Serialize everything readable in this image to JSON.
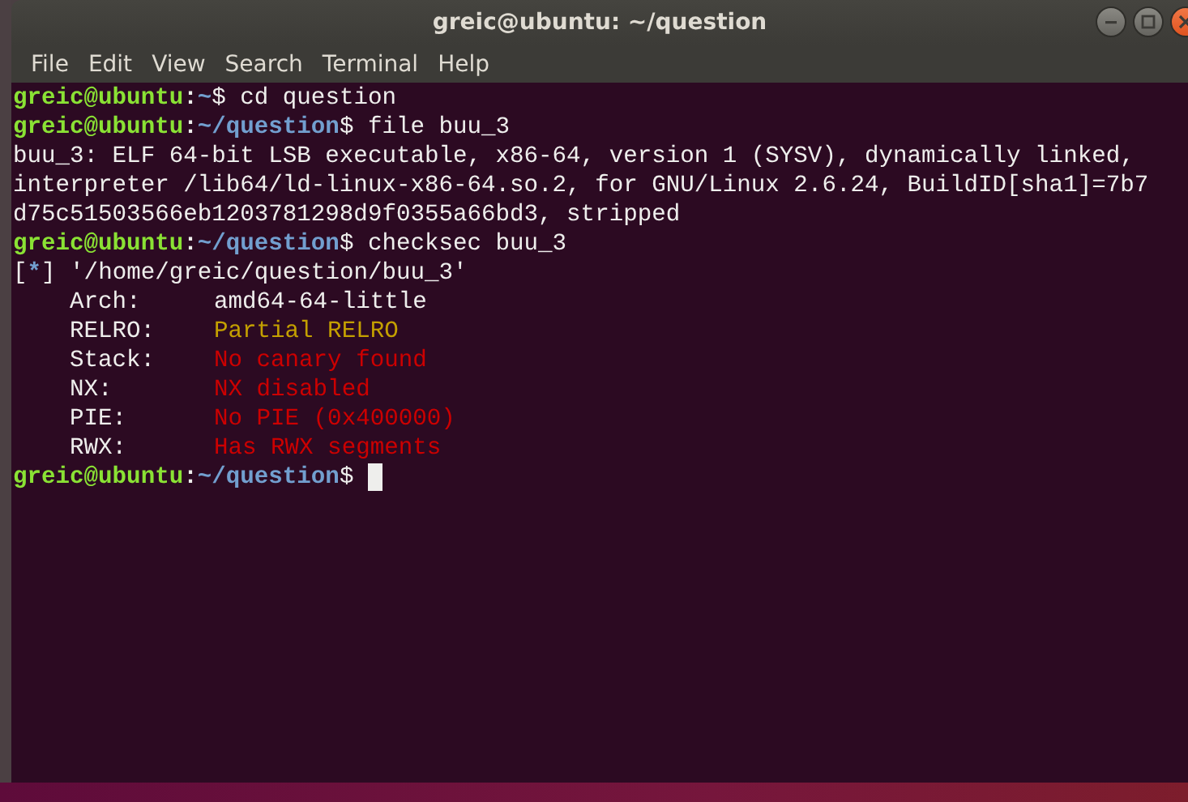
{
  "window": {
    "title": "greic@ubuntu: ~/question"
  },
  "menu": [
    "File",
    "Edit",
    "View",
    "Search",
    "Terminal",
    "Help"
  ],
  "lines": [
    {
      "kind": "prompt",
      "user": "greic@ubuntu",
      "separator": ":",
      "path": "~",
      "symbol": "$",
      "command": " cd question"
    },
    {
      "kind": "prompt",
      "user": "greic@ubuntu",
      "separator": ":",
      "path": "~/question",
      "symbol": "$",
      "command": " file buu_3"
    },
    {
      "kind": "output",
      "text": "buu_3: ELF 64-bit LSB executable, x86-64, version 1 (SYSV), dynamically linked,"
    },
    {
      "kind": "output",
      "text": "interpreter /lib64/ld-linux-x86-64.so.2, for GNU/Linux 2.6.24, BuildID[sha1]=7b7"
    },
    {
      "kind": "output",
      "text": "d75c51503566eb1203781298d9f0355a66bd3, stripped"
    },
    {
      "kind": "prompt",
      "user": "greic@ubuntu",
      "separator": ":",
      "path": "~/question",
      "symbol": "$",
      "command": " checksec buu_3"
    },
    {
      "kind": "info",
      "bracket_open": "[",
      "marker": "*",
      "bracket_close": "]",
      "text": " '/home/greic/question/buu_3'"
    },
    {
      "kind": "field",
      "label": "Arch:",
      "value": "amd64-64-little",
      "color": "#eeeeec"
    },
    {
      "kind": "field",
      "label": "RELRO:",
      "value": "Partial RELRO",
      "color": "#c4a000"
    },
    {
      "kind": "field",
      "label": "Stack:",
      "value": "No canary found",
      "color": "#cc0000"
    },
    {
      "kind": "field",
      "label": "NX:",
      "value": "NX disabled",
      "color": "#cc0000"
    },
    {
      "kind": "field",
      "label": "PIE:",
      "value": "No PIE (0x400000)",
      "color": "#cc0000"
    },
    {
      "kind": "field",
      "label": "RWX:",
      "value": "Has RWX segments",
      "color": "#cc0000"
    },
    {
      "kind": "prompt",
      "user": "greic@ubuntu",
      "separator": ":",
      "path": "~/question",
      "symbol": "$",
      "cursor": true
    }
  ]
}
